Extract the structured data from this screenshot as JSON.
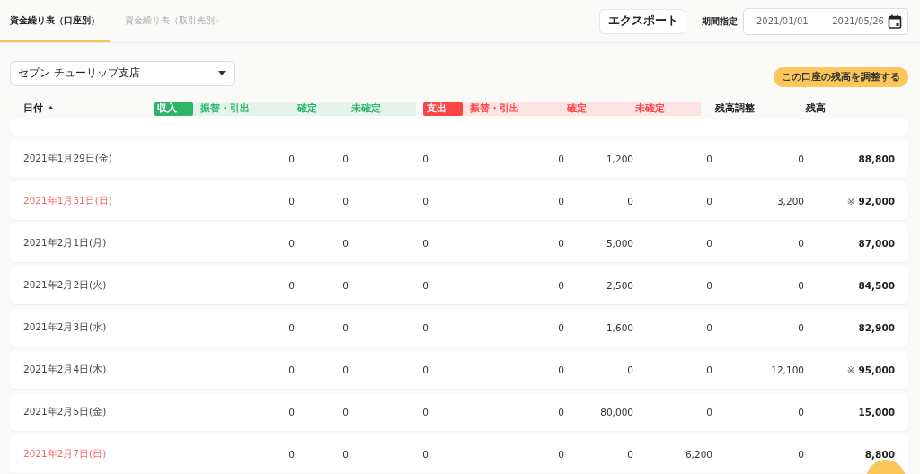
{
  "tabs": [
    {
      "label": "資金繰り表（口座別）",
      "selected": true
    },
    {
      "label": "資金繰り表（取引先別）",
      "selected": false
    }
  ],
  "export_button": "エクスポート",
  "period": {
    "label": "期間指定",
    "start": "2021/01/01",
    "separator": "-",
    "end": "2021/05/26"
  },
  "account_select": {
    "value": "セブン チューリップ支店"
  },
  "adjust_button": "この口座の残高を調整する",
  "table": {
    "date_header": "日付",
    "income": {
      "badge": "収入",
      "columns": [
        "振替・引出",
        "確定",
        "未確定"
      ]
    },
    "expense": {
      "badge": "支出",
      "columns": [
        "振替・引出",
        "確定",
        "未確定"
      ]
    },
    "adjustment_header": "残高調整",
    "balance_header": "残高",
    "rows": [
      {
        "date": "2021年1月29日(金)",
        "holiday": false,
        "values": [
          "0",
          "0",
          "0",
          "0",
          "1,200",
          "0",
          "0"
        ],
        "mark": "",
        "balance": "88,800"
      },
      {
        "date": "2021年1月31日(日)",
        "holiday": true,
        "values": [
          "0",
          "0",
          "0",
          "0",
          "0",
          "0",
          "3,200"
        ],
        "mark": "※",
        "balance": "92,000"
      },
      {
        "date": "2021年2月1日(月)",
        "holiday": false,
        "values": [
          "0",
          "0",
          "0",
          "0",
          "5,000",
          "0",
          "0"
        ],
        "mark": "",
        "balance": "87,000"
      },
      {
        "date": "2021年2月2日(火)",
        "holiday": false,
        "values": [
          "0",
          "0",
          "0",
          "0",
          "2,500",
          "0",
          "0"
        ],
        "mark": "",
        "balance": "84,500"
      },
      {
        "date": "2021年2月3日(水)",
        "holiday": false,
        "values": [
          "0",
          "0",
          "0",
          "0",
          "1,600",
          "0",
          "0"
        ],
        "mark": "",
        "balance": "82,900"
      },
      {
        "date": "2021年2月4日(木)",
        "holiday": false,
        "values": [
          "0",
          "0",
          "0",
          "0",
          "0",
          "0",
          "12,100"
        ],
        "mark": "※",
        "balance": "95,000"
      },
      {
        "date": "2021年2月5日(金)",
        "holiday": false,
        "values": [
          "0",
          "0",
          "0",
          "0",
          "80,000",
          "0",
          "0"
        ],
        "mark": "",
        "balance": "15,000"
      },
      {
        "date": "2021年2月7日(日)",
        "holiday": true,
        "values": [
          "0",
          "0",
          "0",
          "0",
          "0",
          "6,200",
          "0"
        ],
        "mark": "",
        "balance": "8,800"
      }
    ]
  }
}
